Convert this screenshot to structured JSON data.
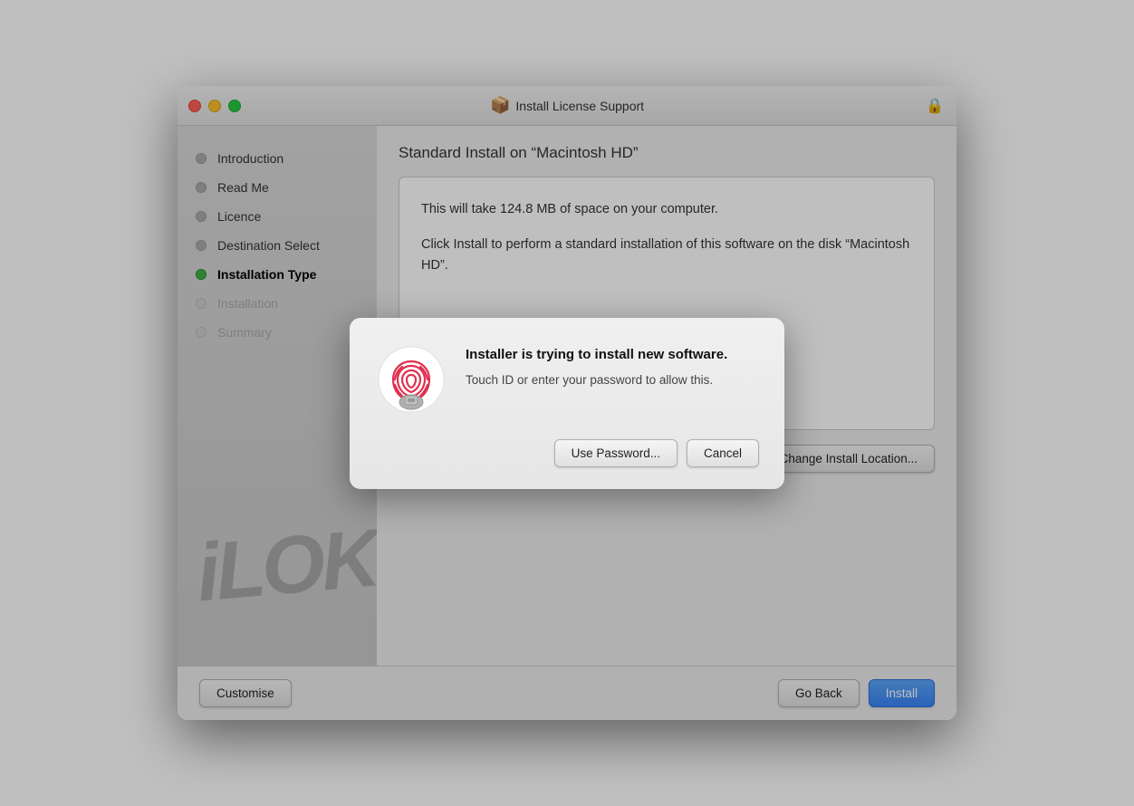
{
  "window": {
    "title": "Install License Support",
    "icon": "📦"
  },
  "sidebar": {
    "items": [
      {
        "id": "introduction",
        "label": "Introduction",
        "state": "inactive"
      },
      {
        "id": "read-me",
        "label": "Read Me",
        "state": "inactive"
      },
      {
        "id": "licence",
        "label": "Licence",
        "state": "inactive"
      },
      {
        "id": "destination-select",
        "label": "Destination Select",
        "state": "inactive"
      },
      {
        "id": "installation-type",
        "label": "Installation Type",
        "state": "active"
      },
      {
        "id": "installation",
        "label": "Installation",
        "state": "dimmed"
      },
      {
        "id": "summary",
        "label": "Summary",
        "state": "dimmed"
      }
    ]
  },
  "content": {
    "install_title": "Standard Install on “Macintosh HD”",
    "install_body_line1": "This will take 124.8 MB of space on your computer.",
    "install_body_line2": "Click Install to perform a standard installation of this software on the disk “Macintosh HD”.",
    "change_location_btn": "Change Install Location..."
  },
  "bottom_bar": {
    "customise_btn": "Customise",
    "go_back_btn": "Go Back",
    "install_btn": "Install"
  },
  "modal": {
    "title": "Installer is trying to install new software.",
    "subtitle": "Touch ID or enter your password to allow this.",
    "use_password_btn": "Use Password...",
    "cancel_btn": "Cancel"
  },
  "watermark": {
    "text": "iLOK"
  }
}
